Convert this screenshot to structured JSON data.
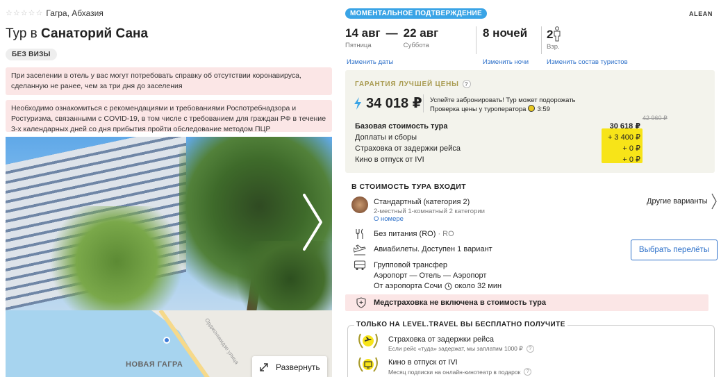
{
  "hotel": {
    "stars": 5,
    "location": "Гагра, Абхазия",
    "title_prefix": "Тур в",
    "title_name": "Санаторий Сана",
    "visa_badge": "БЕЗ ВИЗЫ",
    "alerts": [
      "При заселении в отель у вас могут потребовать справку об отсутствии коронавируса, сделанную не ранее, чем за три дня до заселения",
      "Необходимо ознакомиться с рекомендациями и требованиями Роспотребнадзора и Ростуризма, связанными с COVID-19, в том числе с требованием для граждан РФ в течение 3-х календарных дней со дня прибытия пройти обследование методом ПЦР"
    ]
  },
  "map": {
    "town_label": "НОВАЯ ГАГРА",
    "street_label": "Орджоникидзе улица",
    "expand_label": "Развернуть"
  },
  "booking": {
    "confirm_badge": "МОМЕНТАЛЬНОЕ ПОДТВЕРЖДЕНИЕ",
    "brand": "ALEAN",
    "date_from": "14 авг",
    "date_from_day": "Пятница",
    "date_dash": "—",
    "date_to": "22 авг",
    "date_to_day": "Суббота",
    "nights": "8 ночей",
    "tourists_count": "2",
    "tourists_label": "Взр.",
    "change_dates": "Изменить даты",
    "change_nights": "Изменить ночи",
    "change_tourists": "Изменить состав туристов"
  },
  "price": {
    "guarantee": "ГАРАНТИЯ ЛУЧШЕЙ ЦЕНЫ",
    "qmark": "?",
    "total": "34 018 ₽",
    "hurry_line1": "Успейте забронировать! Тур может подорожать",
    "hurry_line2": "Проверка цены у туроператора",
    "timer": "3:59",
    "old_price": "42 960 ₽",
    "rows": [
      {
        "label": "Базовая стоимость тура",
        "value": "30 618 ₽"
      },
      {
        "label": "Доплаты и сборы",
        "value": "+ 3 400 ₽"
      },
      {
        "label": "Страховка от задержки рейса",
        "value": "+ 0 ₽"
      },
      {
        "label": "Кино в отпуск от IVI",
        "value": "+ 0 ₽"
      }
    ]
  },
  "included": {
    "title": "В СТОИМОСТЬ ТУРА ВХОДИТ",
    "room_name": "Стандартный (категория 2)",
    "room_sub": "2-местный 1-комнатный 2 категории",
    "room_link": "О номере",
    "other_variants": "Другие варианты",
    "meal": "Без питания (RO)",
    "meal_code": "· RO",
    "flights": "Авиабилеты. Доступен 1 вариант",
    "flights_button": "Выбрать перелёты",
    "transfer_1": "Групповой трансфер",
    "transfer_2": "Аэропорт — Отель — Аэропорт",
    "transfer_3_prefix": "От аэропорта Сочи",
    "transfer_3_time": "около 32 мин",
    "medical": "Медстраховка не включена в стоимость тура"
  },
  "free": {
    "title": "ТОЛЬКО НА LEVEL.TRAVEL ВЫ БЕСПЛАТНО ПОЛУЧИТЕ",
    "items": [
      {
        "name": "Страховка от задержки рейса",
        "sub": "Если рейс «туда» задержат, мы заплатим 1000 ₽"
      },
      {
        "name": "Кино в отпуск от IVI",
        "sub": "Месяц подписки на онлайн-кинотеатр в подарок"
      }
    ]
  },
  "colors": {
    "accent_blue": "#2b6fc9",
    "badge_blue": "#3aa4e6",
    "alert_pink": "#fbe6e6",
    "highlight_yellow": "#f7e418",
    "price_box_bg": "#f3f3ec"
  }
}
